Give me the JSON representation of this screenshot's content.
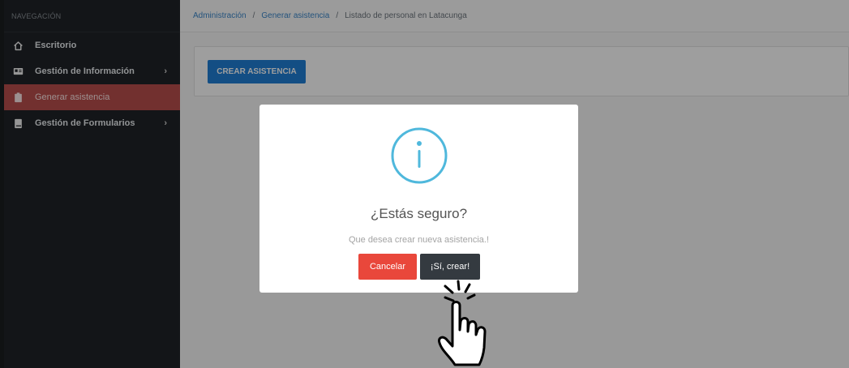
{
  "sidebar": {
    "header": "NAVEGACIÓN",
    "items": [
      {
        "label": "Escritorio",
        "icon": "home-icon"
      },
      {
        "label": "Gestión de Información",
        "icon": "id-card-icon",
        "chevron": "›"
      },
      {
        "label": "Generar asistencia",
        "icon": "clipboard-icon",
        "active": true
      },
      {
        "label": "Gestión de Formularios",
        "icon": "book-icon",
        "chevron": "›"
      }
    ]
  },
  "breadcrumb": {
    "items": [
      "Administración",
      "Generar asistencia",
      "Listado de personal en Latacunga"
    ],
    "separator": "/"
  },
  "main": {
    "create_button": "CREAR ASISTENCIA"
  },
  "modal": {
    "icon": "info-icon",
    "title": "¿Estás seguro?",
    "text": "Que desea crear nueva asistencia.!",
    "cancel_label": "Cancelar",
    "confirm_label": "¡Sí, crear!"
  },
  "colors": {
    "sidebar_bg": "#1f2327",
    "active_item": "#b94e4c",
    "primary": "#1f7fd6",
    "cancel": "#e9473b",
    "confirm": "#343a40",
    "info": "#4fb8dc"
  }
}
